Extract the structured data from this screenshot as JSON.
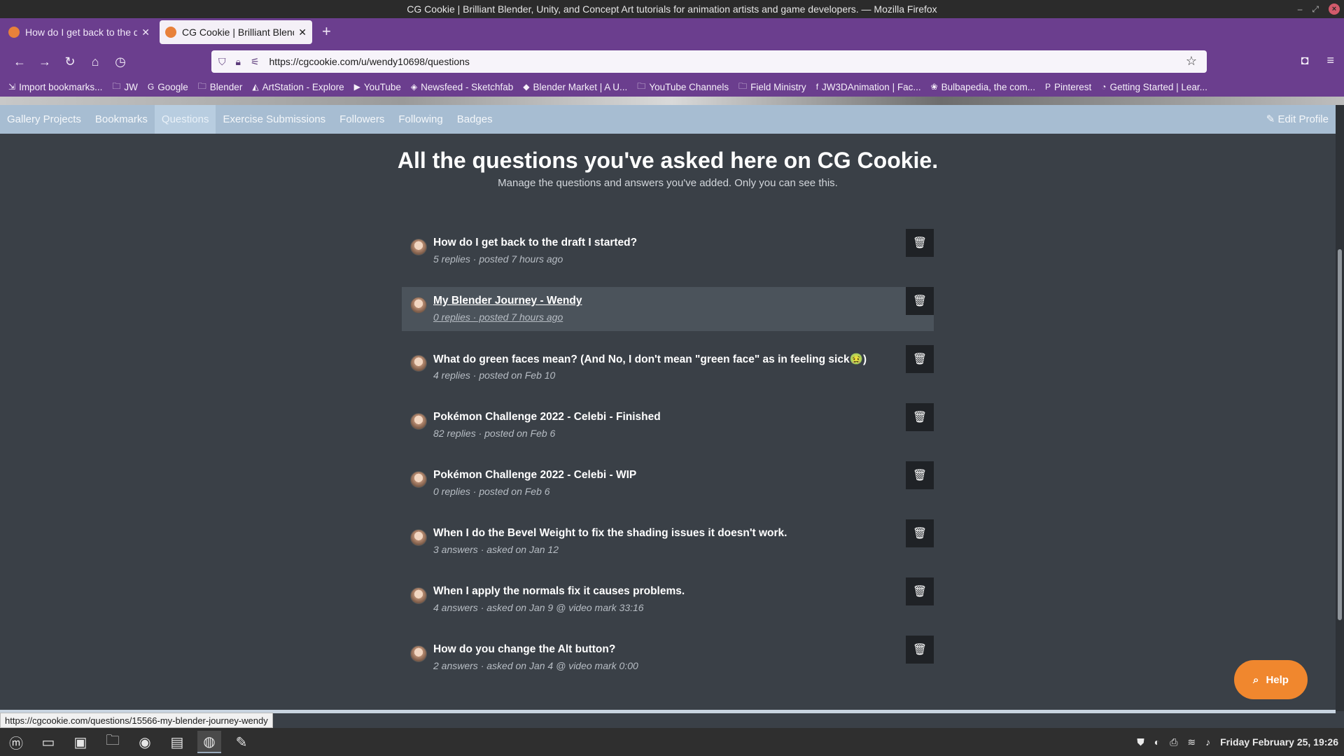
{
  "window": {
    "title": "CG Cookie | Brilliant Blender, Unity, and Concept Art tutorials for animation artists and game developers. — Mozilla Firefox"
  },
  "tabs": [
    {
      "label": "How do I get back to the dr",
      "active": false
    },
    {
      "label": "CG Cookie | Brilliant Blende",
      "active": true
    }
  ],
  "url": "https://cgcookie.com/u/wendy10698/questions",
  "bookmarks": [
    {
      "label": "Import bookmarks...",
      "icon": "import-icon"
    },
    {
      "label": "JW",
      "icon": "folder-icon"
    },
    {
      "label": "Google",
      "icon": "google-icon"
    },
    {
      "label": "Blender",
      "icon": "folder-icon"
    },
    {
      "label": "ArtStation - Explore",
      "icon": "artstation-icon"
    },
    {
      "label": "YouTube",
      "icon": "youtube-icon"
    },
    {
      "label": "Newsfeed - Sketchfab",
      "icon": "sketchfab-icon"
    },
    {
      "label": "Blender Market | A U...",
      "icon": "blendermarket-icon"
    },
    {
      "label": "YouTube Channels",
      "icon": "folder-icon"
    },
    {
      "label": "Field Ministry",
      "icon": "folder-icon"
    },
    {
      "label": "JW3DAnimation | Fac...",
      "icon": "facebook-icon"
    },
    {
      "label": "Bulbapedia, the com...",
      "icon": "bulbapedia-icon"
    },
    {
      "label": "Pinterest",
      "icon": "pinterest-icon"
    },
    {
      "label": "Getting Started | Lear...",
      "icon": "rss-icon"
    }
  ],
  "profile_nav": {
    "items": [
      {
        "label": "Gallery Projects",
        "active": false
      },
      {
        "label": "Bookmarks",
        "active": false
      },
      {
        "label": "Questions",
        "active": true
      },
      {
        "label": "Exercise Submissions",
        "active": false
      },
      {
        "label": "Followers",
        "active": false
      },
      {
        "label": "Following",
        "active": false
      },
      {
        "label": "Badges",
        "active": false
      }
    ],
    "edit_label": "Edit Profile"
  },
  "page": {
    "heading": "All the questions you've asked here on CG Cookie.",
    "subheading": "Manage the questions and answers you've added. Only you can see this."
  },
  "questions": [
    {
      "title": "How do I get back to the draft I started?",
      "meta": "5 replies · posted 7 hours ago",
      "hover": false
    },
    {
      "title": "My Blender Journey - Wendy",
      "meta": "0 replies · posted 7 hours ago",
      "hover": true
    },
    {
      "title": "What do green faces mean? (And No, I don't mean \"green face\" as in feeling sick🤢)",
      "meta": "4 replies · posted on Feb 10",
      "hover": false
    },
    {
      "title": "Pokémon Challenge 2022 - Celebi - Finished",
      "meta": "82 replies · posted on Feb 6",
      "hover": false
    },
    {
      "title": "Pokémon Challenge 2022 - Celebi - WIP",
      "meta": "0 replies · posted on Feb 6",
      "hover": false
    },
    {
      "title": "When I do the Bevel Weight to fix the shading issues it doesn't work.",
      "meta": "3 answers · asked on Jan 12",
      "hover": false
    },
    {
      "title": "When I apply the normals fix it causes problems.",
      "meta": "4 answers · asked on Jan 9 @ video mark 33:16",
      "hover": false
    },
    {
      "title": "How do you change the Alt button?",
      "meta": "2 answers · asked on Jan 4 @ video mark 0:00",
      "hover": false
    }
  ],
  "help_label": "Help",
  "status_url": "https://cgcookie.com/questions/15566-my-blender-journey-wendy",
  "clock": "Friday February 25, 19:26",
  "colors": {
    "firefox_purple": "#6b3e8e",
    "profile_nav": "#a7bdd2",
    "page_bg": "#3a4047",
    "help_orange": "#f0872e"
  }
}
